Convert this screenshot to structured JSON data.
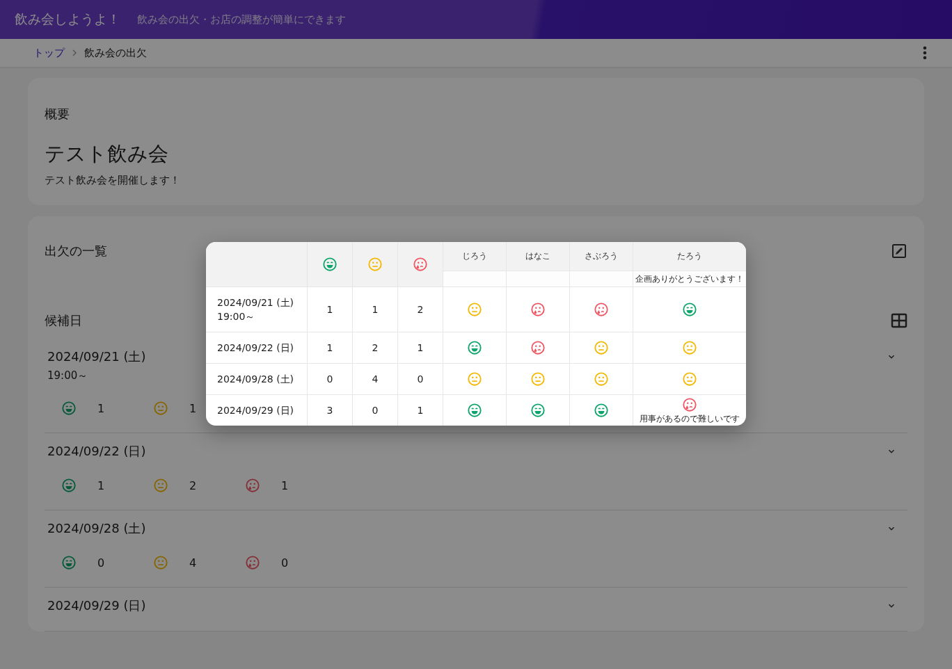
{
  "header": {
    "title": "飲み会しようよ！",
    "subtitle": "飲み会の出欠・お店の調整が簡単にできます"
  },
  "breadcrumb": [
    {
      "label": "トップ",
      "link": true
    },
    {
      "label": "飲み会の出欠",
      "link": false
    }
  ],
  "overview": {
    "heading": "概要",
    "title": "テスト飲み会",
    "description": "テスト飲み会を開催します！"
  },
  "attendance": {
    "heading": "出欠の一覧",
    "candidates_heading": "候補日",
    "candidates": [
      {
        "date": "2024/09/21 (土)",
        "time": "19:00～",
        "counts": [
          {
            "kind": "good",
            "count": "1"
          },
          {
            "kind": "maybe",
            "count": "1"
          }
        ]
      },
      {
        "date": "2024/09/22 (日)",
        "counts": [
          {
            "kind": "good",
            "count": "1"
          },
          {
            "kind": "maybe",
            "count": "2"
          },
          {
            "kind": "bad",
            "count": "1"
          }
        ]
      },
      {
        "date": "2024/09/28 (土)",
        "counts": [
          {
            "kind": "good",
            "count": "0"
          },
          {
            "kind": "maybe",
            "count": "4"
          },
          {
            "kind": "bad",
            "count": "0"
          }
        ]
      },
      {
        "date": "2024/09/29 (日)"
      }
    ]
  },
  "modal": {
    "columns": [
      {
        "kind": "good"
      },
      {
        "kind": "maybe"
      },
      {
        "kind": "bad"
      }
    ],
    "members": [
      {
        "name": "じろう"
      },
      {
        "name": "はなこ"
      },
      {
        "name": "さぶろう"
      },
      {
        "name": "たろう",
        "comment": "企画ありがとうございます！"
      }
    ],
    "rows": [
      {
        "date": "2024/09/21 (土)",
        "time": "19:00～",
        "counts": [
          "1",
          "1",
          "2"
        ],
        "answers": [
          {
            "kind": "maybe"
          },
          {
            "kind": "bad"
          },
          {
            "kind": "bad"
          },
          {
            "kind": "good"
          }
        ]
      },
      {
        "date": "2024/09/22 (日)",
        "counts": [
          "1",
          "2",
          "1"
        ],
        "answers": [
          {
            "kind": "good"
          },
          {
            "kind": "bad"
          },
          {
            "kind": "maybe"
          },
          {
            "kind": "maybe"
          }
        ]
      },
      {
        "date": "2024/09/28 (土)",
        "counts": [
          "0",
          "4",
          "0"
        ],
        "answers": [
          {
            "kind": "maybe"
          },
          {
            "kind": "maybe"
          },
          {
            "kind": "maybe"
          },
          {
            "kind": "maybe"
          }
        ]
      },
      {
        "date": "2024/09/29 (日)",
        "counts": [
          "3",
          "0",
          "1"
        ],
        "answers": [
          {
            "kind": "good"
          },
          {
            "kind": "good"
          },
          {
            "kind": "good"
          },
          {
            "kind": "bad",
            "comment": "用事があるので難しいです"
          }
        ]
      }
    ]
  }
}
